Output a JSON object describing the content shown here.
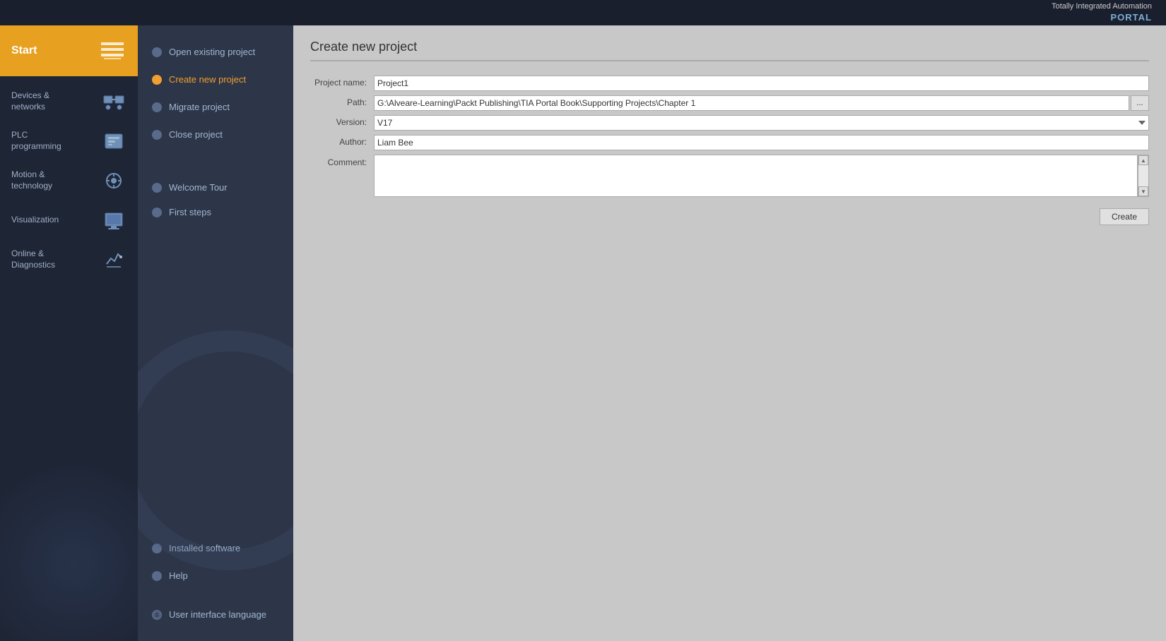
{
  "topBar": {
    "line1": "Totally Integrated Automation",
    "line2": "PORTAL"
  },
  "sidebar": {
    "startLabel": "Start",
    "items": [
      {
        "id": "devices-networks",
        "label": "Devices &\nnetworks",
        "iconType": "network"
      },
      {
        "id": "plc-programming",
        "label": "PLC\nprogramming",
        "iconType": "plc"
      },
      {
        "id": "motion-technology",
        "label": "Motion &\ntechnology",
        "iconType": "motion"
      },
      {
        "id": "visualization",
        "label": "Visualization",
        "iconType": "visual"
      },
      {
        "id": "online-diagnostics",
        "label": "Online &\nDiagnostics",
        "iconType": "diag"
      }
    ]
  },
  "middlePanel": {
    "mainItems": [
      {
        "id": "open-existing",
        "label": "Open existing project",
        "active": false
      },
      {
        "id": "create-new",
        "label": "Create new project",
        "active": true
      },
      {
        "id": "migrate-project",
        "label": "Migrate project",
        "active": false
      },
      {
        "id": "close-project",
        "label": "Close project",
        "active": false
      }
    ],
    "tourItems": [
      {
        "id": "welcome-tour",
        "label": "Welcome Tour",
        "active": false
      },
      {
        "id": "first-steps",
        "label": "First steps",
        "active": false
      }
    ],
    "bottomItems": [
      {
        "id": "installed-software",
        "label": "Installed software",
        "active": false
      },
      {
        "id": "help",
        "label": "Help",
        "active": false
      }
    ],
    "langItem": {
      "id": "ui-language",
      "label": "User interface language"
    }
  },
  "createProject": {
    "title": "Create new project",
    "fields": {
      "projectName": {
        "label": "Project name:",
        "value": "Project1"
      },
      "path": {
        "label": "Path:",
        "value": "G:\\Alveare-Learning\\Packt Publishing\\TIA Portal Book\\Supporting Projects\\Chapter 1",
        "browseButton": "..."
      },
      "version": {
        "label": "Version:",
        "value": "V17"
      },
      "author": {
        "label": "Author:",
        "value": "Liam Bee"
      },
      "comment": {
        "label": "Comment:",
        "value": ""
      }
    },
    "createButton": "Create"
  }
}
